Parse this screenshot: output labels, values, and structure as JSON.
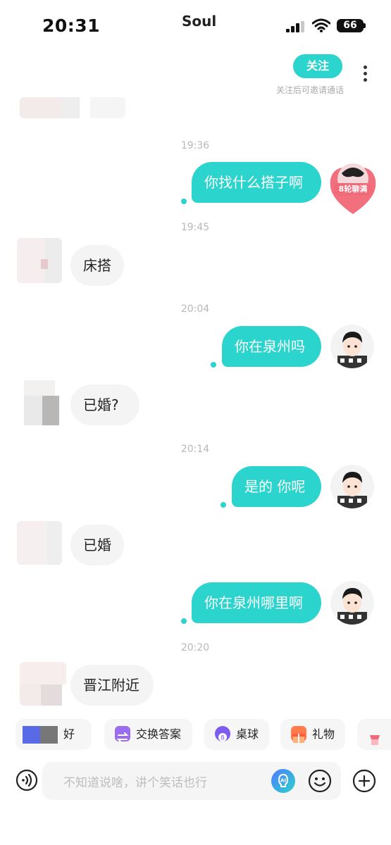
{
  "status_bar": {
    "time": "20:31",
    "app_name": "Soul",
    "battery": "66"
  },
  "header": {
    "follow_label": "关注",
    "follow_hint": "关注后可邀请通话"
  },
  "messages": [
    {
      "type": "time",
      "text": "19:36"
    },
    {
      "type": "out",
      "text": "你找什么搭子啊",
      "avatar_badge": "8轮聊满"
    },
    {
      "type": "time",
      "text": "19:45"
    },
    {
      "type": "in",
      "text": "床搭"
    },
    {
      "type": "time",
      "text": "20:04"
    },
    {
      "type": "out",
      "text": "你在泉州吗"
    },
    {
      "type": "in",
      "text": "已婚?"
    },
    {
      "type": "time",
      "text": "20:14"
    },
    {
      "type": "out",
      "text": "是的 你呢"
    },
    {
      "type": "in",
      "text": "已婚"
    },
    {
      "type": "out",
      "text": "你在泉州哪里啊"
    },
    {
      "type": "time",
      "text": "20:20"
    },
    {
      "type": "in",
      "text": "晋江附近"
    }
  ],
  "quick_chips": [
    {
      "label": "好",
      "icon": "blurred-icon"
    },
    {
      "label": "交换答案",
      "icon": "swap-icon",
      "color": "#9b6bf0"
    },
    {
      "label": "桌球",
      "icon": "billiard-icon",
      "color": "#7d5cf0"
    },
    {
      "label": "礼物",
      "icon": "gift-icon",
      "color": "#ff7a4d"
    }
  ],
  "input": {
    "placeholder": "不知道说啥，讲个笑话也行"
  },
  "colors": {
    "accent": "#2bd4cc",
    "badge": "#f06a7a"
  }
}
